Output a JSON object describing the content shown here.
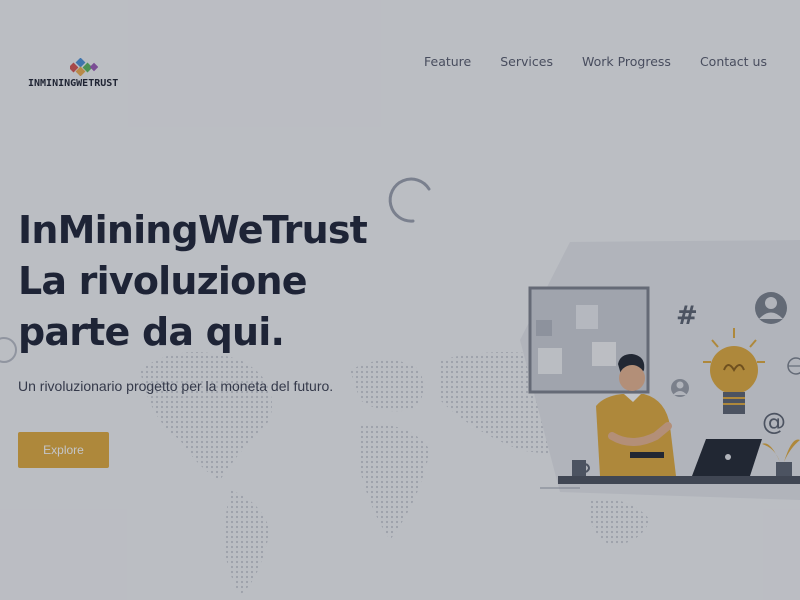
{
  "header": {
    "logo_text": "INMININGWETRUST",
    "nav": [
      {
        "label": "Feature"
      },
      {
        "label": "Services"
      },
      {
        "label": "Work Progress"
      },
      {
        "label": "Contact us"
      }
    ]
  },
  "hero": {
    "title_lines": [
      "InMiningWeTrust",
      "La rivoluzione",
      "parte da qui."
    ],
    "subtitle": "Un rivoluzionario progetto per la moneta del futuro.",
    "cta_label": "Explore"
  },
  "illustration": {
    "icons": [
      "hashtag-icon",
      "user-avatar-icon",
      "lightbulb-icon",
      "at-sign-icon",
      "globe-icon"
    ],
    "hashtag": "#",
    "at": "@"
  },
  "colors": {
    "accent": "#e2ab3b",
    "title": "#1b2034",
    "background": "#f4f5f7"
  }
}
